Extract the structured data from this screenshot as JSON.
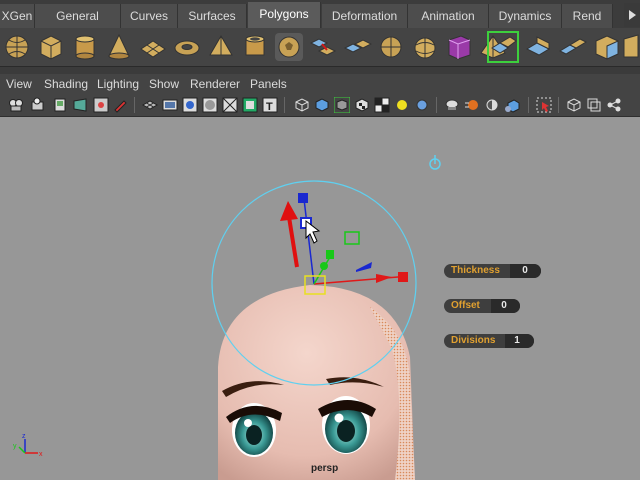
{
  "shelf_tabs": [
    {
      "label": "XGen",
      "active": false
    },
    {
      "label": "General",
      "active": false
    },
    {
      "label": "Curves",
      "active": false
    },
    {
      "label": "Surfaces",
      "active": false
    },
    {
      "label": "Polygons",
      "active": true
    },
    {
      "label": "Deformation",
      "active": false
    },
    {
      "label": "Animation",
      "active": false
    },
    {
      "label": "Dynamics",
      "active": false
    },
    {
      "label": "Rend",
      "active": false
    }
  ],
  "shelf_icons": [
    "poly-sphere-icon",
    "poly-cube-icon",
    "poly-cylinder-icon",
    "poly-cone-icon",
    "poly-plane-icon",
    "poly-torus-icon",
    "poly-prism-icon",
    "poly-pipe-icon",
    "poly-soccer-ball-icon",
    "combine-icon",
    "separate-icon",
    "extract-icon",
    "smooth-icon",
    "boolean-icon",
    "poly-pyramid-icon",
    "multi-cut-icon",
    "extrude-icon",
    "bridge-icon",
    "bevel-icon",
    "append-polygon-icon"
  ],
  "panel_menus": [
    "View",
    "Shading",
    "Lighting",
    "Show",
    "Renderer",
    "Panels"
  ],
  "viewport_toolbar_icons": [
    "select-camera-icon",
    "camera-attributes-icon",
    "bookmarks-icon",
    "image-plane-icon",
    "2d-pan-zoom-icon",
    "grease-pencil-icon",
    "grid-icon",
    "film-gate-icon",
    "resolution-gate-icon",
    "gate-mask-icon",
    "field-chart-icon",
    "safe-action-icon",
    "safe-title-icon",
    "wireframe-icon",
    "smooth-shade-icon",
    "wireframe-on-shaded-icon",
    "textured-icon",
    "use-all-lights-icon",
    "shadows-icon",
    "screen-space-ao-icon",
    "motion-blur-icon",
    "anti-aliasing-icon",
    "depth-of-field-icon",
    "isolate-select-icon",
    "xray-icon",
    "xray-active-components-icon",
    "xray-joints-icon"
  ],
  "hud_fields": [
    {
      "label": "Thickness",
      "value": "0"
    },
    {
      "label": "Offset",
      "value": "0"
    },
    {
      "label": "Divisions",
      "value": "1"
    }
  ],
  "camera_label": "persp",
  "colors": {
    "viewport_bg": "#979797",
    "active_tab": "#5b5b5b",
    "hud_label": "#e0a030",
    "manip_x": "#e01818",
    "manip_y": "#18c818",
    "manip_z": "#1a28d0",
    "rotate_ring": "#5fd0f0",
    "annotation_arrow": "#e01010"
  }
}
